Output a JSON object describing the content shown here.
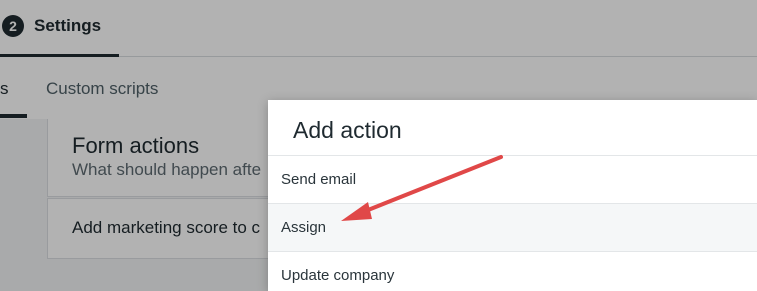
{
  "steps": {
    "current_number": "2",
    "current_label": "Settings"
  },
  "subtabs": {
    "active_fragment": "s",
    "custom": "Custom scripts"
  },
  "background_panels": {
    "form_actions_title": "Form actions",
    "form_actions_subtitle": "What should happen afte",
    "marketing_score_text": "Add marketing score to c"
  },
  "modal": {
    "title": "Add action",
    "actions": [
      {
        "label": "Send email"
      },
      {
        "label": "Assign"
      },
      {
        "label": "Update company"
      }
    ],
    "highlighted_action": "Assign"
  },
  "annotation": {
    "arrow_color": "#e04848"
  },
  "colors": {
    "primary_dark": "#1f2a30",
    "overlay": "rgba(0,0,0,0.30)",
    "modal_bg": "#ffffff"
  }
}
